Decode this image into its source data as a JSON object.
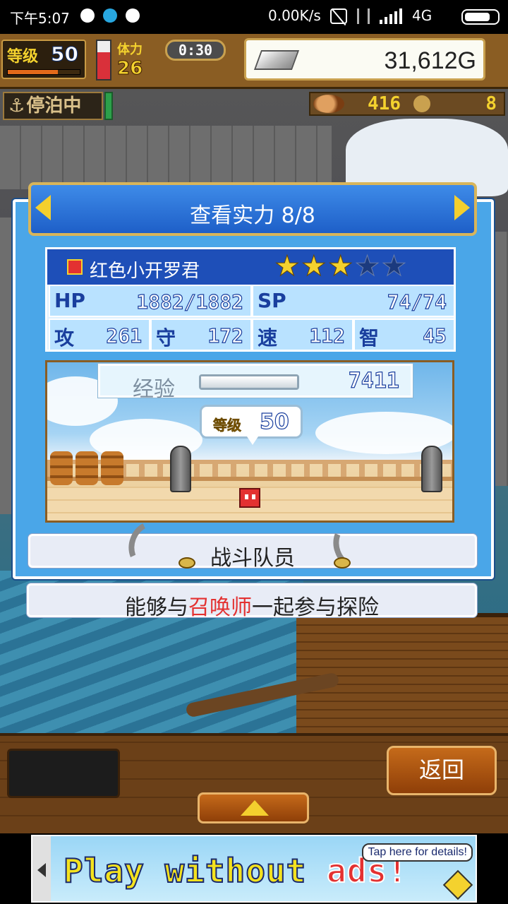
{
  "status_bar": {
    "time": "下午5:07",
    "network_speed": "0.00K/s",
    "network_type": "4G"
  },
  "hud": {
    "level_label": "等级",
    "level_value": "50",
    "stamina_label": "体力",
    "stamina_value": "26",
    "timer": "0:30",
    "gold": "31,612G",
    "docked_label": "停泊中",
    "food": "416",
    "coins": "8",
    "level_progress": 0.7,
    "stamina_level": 0.7
  },
  "panel": {
    "title": "查看实力 8/8",
    "character": {
      "name": "红色小开罗君",
      "stars_filled": 3,
      "stars_total": 5,
      "hp_label": "HP",
      "hp_value": "1882/1882",
      "sp_label": "SP",
      "sp_value": "74/74",
      "atk_label": "攻",
      "atk_value": "261",
      "def_label": "守",
      "def_value": "172",
      "spd_label": "速",
      "spd_value": "112",
      "int_label": "智",
      "int_value": "45"
    },
    "experience": {
      "label": "经验",
      "value": "7411",
      "level_label": "等级",
      "level_value": "50"
    },
    "role": "战斗队员",
    "description_before": "能够与",
    "description_highlight": "召唤师",
    "description_after": "一起参与探险"
  },
  "bottom": {
    "back_label": "返回"
  },
  "ad": {
    "text_before": "Play without",
    "text_highlight": "ads!",
    "tip": "Tap here for details!"
  },
  "colors": {
    "accent_gold": "#f4d22e",
    "panel_blue": "#4aa6e8",
    "highlight_red": "#e33131"
  }
}
